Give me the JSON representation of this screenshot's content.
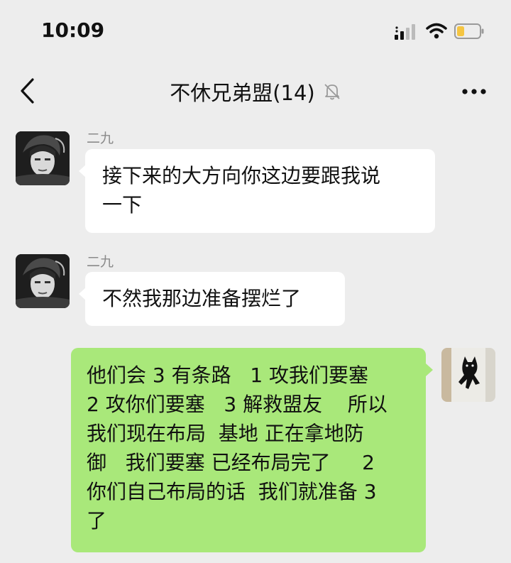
{
  "status": {
    "time": "10:09",
    "icons": [
      "signal-icon",
      "wifi-icon",
      "battery-low-icon"
    ],
    "battery_color": "#f5c542"
  },
  "nav": {
    "title": "不休兄弟盟(14)",
    "icons": [
      "back-icon",
      "mute-bell-icon",
      "more-icon"
    ]
  },
  "colors": {
    "background": "#ededed",
    "incoming_bubble": "#ffffff",
    "outgoing_bubble": "#a9e87a"
  },
  "messages": [
    {
      "direction": "incoming",
      "sender": "二九",
      "lines": [
        "接下来的大方向你这边要跟我说",
        "一下"
      ]
    },
    {
      "direction": "incoming",
      "sender": "二九",
      "lines": [
        "不然我那边准备摆烂了"
      ]
    },
    {
      "direction": "outgoing",
      "lines": [
        "他们会 3 有条路   1 攻我们要塞",
        "2 攻你们要塞   3 解救盟友    所以",
        "我们现在布局  基地 正在拿地防",
        "御   我们要塞 已经布局完了     2",
        "你们自己布局的话  我们就准备 3",
        "了"
      ]
    }
  ]
}
